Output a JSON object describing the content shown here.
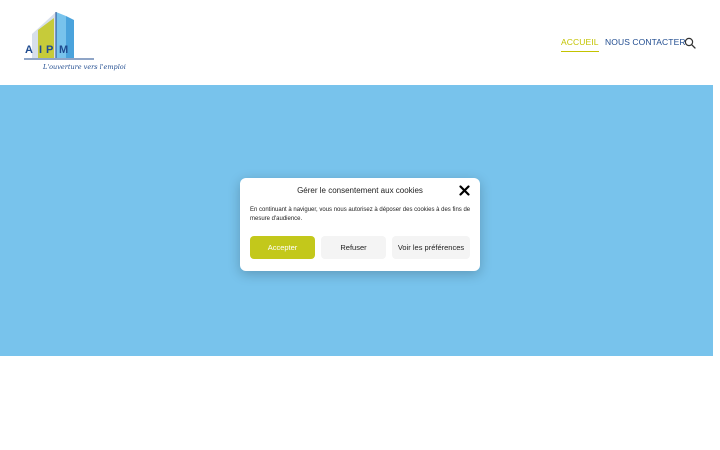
{
  "header": {
    "logo_letters": [
      "A",
      "I",
      "P",
      "M"
    ],
    "logo_tagline": "L'ouverture vers l'emploi",
    "nav": {
      "home": "ACCUEIL",
      "contact": "NOUS CONTACTER"
    },
    "search_icon": "search-icon"
  },
  "cookie_modal": {
    "title": "Gérer le consentement aux cookies",
    "close_icon": "close-icon",
    "text": "En continuant à naviguer, vous nous autorisez à déposer des cookies à des fins de mesure d'audience.",
    "buttons": {
      "accept": "Accepter",
      "refuse": "Refuser",
      "preferences": "Voir les préférences"
    }
  },
  "colors": {
    "hero_background": "#78c3ec",
    "accent_lime": "#c3c81b",
    "brand_blue": "#1f4b8f"
  }
}
